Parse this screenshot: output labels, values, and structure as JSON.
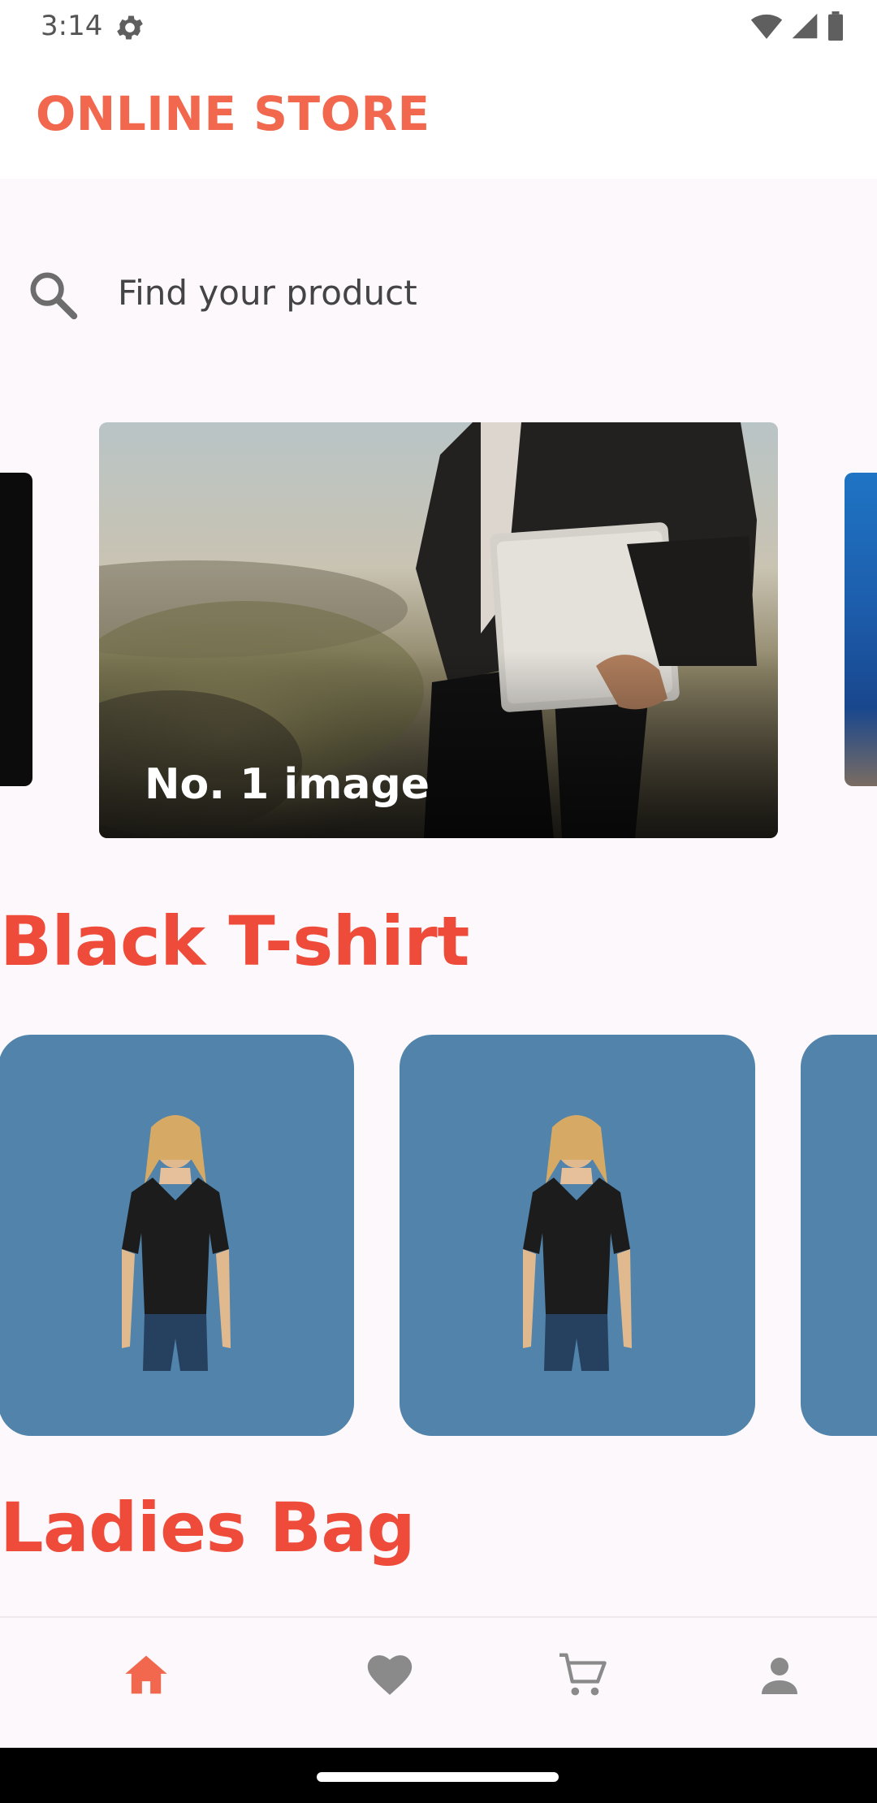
{
  "status_bar": {
    "time": "3:14"
  },
  "app_bar": {
    "title": "ONLINE STORE"
  },
  "search": {
    "placeholder": "Find your product"
  },
  "carousel": {
    "caption": "No. 1 image"
  },
  "sections": [
    {
      "title": "Black T-shirt"
    },
    {
      "title": "Ladies Bag"
    }
  ],
  "colors": {
    "accent": "#f2684e",
    "section_title": "#ee4b3a",
    "product_card": "#5183ab",
    "nav_active": "#f2684e",
    "nav_inactive": "#8a8a8a"
  },
  "bottom_nav": [
    {
      "icon": "home-icon",
      "active": true
    },
    {
      "icon": "heart-icon",
      "active": false
    },
    {
      "icon": "cart-icon",
      "active": false
    },
    {
      "icon": "person-icon",
      "active": false
    }
  ]
}
